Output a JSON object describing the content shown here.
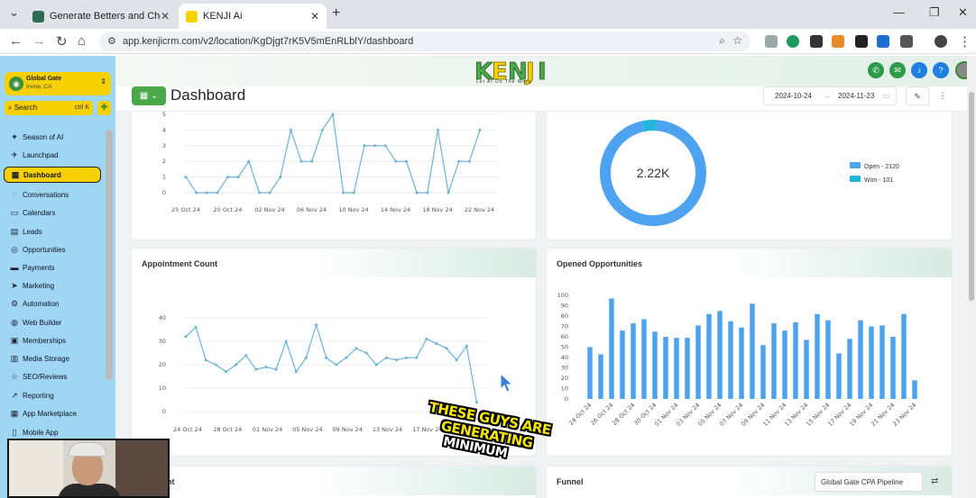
{
  "browser": {
    "tabs": [
      {
        "label": "Generate Betters and Cheaper L",
        "active": false
      },
      {
        "label": "KENJI Ai",
        "active": true
      }
    ],
    "url": "app.kenjicrm.com/v2/location/KgDjgt7rK5V5mEnRLblY/dashboard"
  },
  "brand": {
    "logo": "KENJI",
    "tagline": "Let AI Do The Work",
    "accent": "#f6d000",
    "green": "#4aa84a"
  },
  "sidebar": {
    "location_name": "Global Gate",
    "location_sub": "Irvine, CA",
    "search_label": "Search",
    "search_shortcut": "ctrl K",
    "items": [
      {
        "label": "Season of AI",
        "icon": "sparkle-icon"
      },
      {
        "label": "Launchpad",
        "icon": "rocket-icon"
      },
      {
        "label": "Dashboard",
        "icon": "grid-icon",
        "active": true
      },
      {
        "label": "Conversations",
        "icon": "chat-icon"
      },
      {
        "label": "Calendars",
        "icon": "calendar-icon"
      },
      {
        "label": "Leads",
        "icon": "contacts-icon"
      },
      {
        "label": "Opportunities",
        "icon": "target-icon"
      },
      {
        "label": "Payments",
        "icon": "card-icon"
      },
      {
        "label": "Marketing",
        "icon": "send-icon"
      },
      {
        "label": "Automation",
        "icon": "automation-icon"
      },
      {
        "label": "Web Builder",
        "icon": "globe-icon"
      },
      {
        "label": "Memberships",
        "icon": "membership-icon"
      },
      {
        "label": "Media Storage",
        "icon": "folder-icon"
      },
      {
        "label": "SEO/Reviews",
        "icon": "star-icon"
      },
      {
        "label": "Reporting",
        "icon": "trend-icon"
      },
      {
        "label": "App Marketplace",
        "icon": "apps-icon"
      },
      {
        "label": "Mobile App",
        "icon": "phone-icon"
      }
    ]
  },
  "header": {
    "title": "Dashboard",
    "date_from": "2024-10-24",
    "date_to": "2024-11-23"
  },
  "cards": {
    "top_left_chart": {
      "type": "line",
      "x_ticks": [
        "25 Oct 24",
        "20 Oct 24",
        "02 Nov 24",
        "06 Nov 24",
        "10 Nov 24",
        "14 Nov 24",
        "18 Nov 24",
        "22 Nov 24"
      ],
      "y_ticks": [
        "0",
        "1",
        "2",
        "3",
        "4",
        "5"
      ]
    },
    "donut": {
      "center_label": "2.22K",
      "legend": [
        {
          "label": "Open - 2120",
          "value": 2120,
          "color": "#4da3f0"
        },
        {
          "label": "Won - 101",
          "value": 101,
          "color": "#1fb6d9"
        }
      ]
    },
    "appointment": {
      "title": "Appointment Count"
    },
    "opened": {
      "title": "Opened Opportunities"
    },
    "bottom_left": {
      "title": "ts Count"
    },
    "funnel": {
      "title": "Funnel",
      "pipeline": "Global Gate CPA Pipeline"
    }
  },
  "chart_data": [
    {
      "type": "line",
      "title": "",
      "x": [
        "25 Oct 24",
        "26 Oct 24",
        "27 Oct 24",
        "28 Oct 24",
        "29 Oct 24",
        "30 Oct 24",
        "31 Oct 24",
        "01 Nov 24",
        "02 Nov 24",
        "03 Nov 24",
        "04 Nov 24",
        "05 Nov 24",
        "06 Nov 24",
        "07 Nov 24",
        "08 Nov 24",
        "09 Nov 24",
        "10 Nov 24",
        "11 Nov 24",
        "12 Nov 24",
        "13 Nov 24",
        "14 Nov 24",
        "15 Nov 24",
        "16 Nov 24",
        "17 Nov 24",
        "18 Nov 24",
        "19 Nov 24",
        "20 Nov 24",
        "21 Nov 24",
        "22 Nov 24"
      ],
      "values": [
        1,
        0,
        0,
        0,
        1,
        1,
        2,
        0,
        0,
        1,
        4,
        2,
        2,
        4,
        5,
        0,
        0,
        3,
        3,
        3,
        2,
        2,
        0,
        0,
        4,
        0,
        2,
        2,
        4
      ],
      "ylim": [
        0,
        5
      ],
      "color": "#6ab3d9"
    },
    {
      "type": "pie",
      "title": "",
      "categories": [
        "Open",
        "Won"
      ],
      "values": [
        2120,
        101
      ]
    },
    {
      "type": "line",
      "title": "Appointment Count",
      "x_ticks": [
        "24 Oct 24",
        "28 Oct 24",
        "01 Nov 24",
        "05 Nov 24",
        "09 Nov 24",
        "13 Nov 24",
        "17 Nov 24",
        "21 Nov 24"
      ],
      "values": [
        32,
        36,
        22,
        20,
        17,
        20,
        24,
        18,
        19,
        18,
        30,
        17,
        23,
        37,
        23,
        20,
        23,
        27,
        25,
        20,
        23,
        22,
        23,
        23,
        31,
        29,
        27,
        22,
        28,
        4
      ],
      "ylim": [
        0,
        40
      ],
      "color": "#6ab3d9"
    },
    {
      "type": "bar",
      "title": "Opened Opportunities",
      "x_ticks": [
        "24 Oct 24",
        "26 Oct 24",
        "28 Oct 24",
        "30 Oct 24",
        "01 Nov 24",
        "03 Nov 24",
        "05 Nov 24",
        "07 Nov 24",
        "09 Nov 24",
        "11 Nov 24",
        "13 Nov 24",
        "15 Nov 24",
        "17 Nov 24",
        "19 Nov 24",
        "21 Nov 24",
        "23 Nov 24"
      ],
      "values": [
        50,
        43,
        97,
        66,
        73,
        77,
        65,
        60,
        59,
        59,
        71,
        82,
        85,
        75,
        69,
        92,
        52,
        73,
        66,
        74,
        57,
        82,
        76,
        44,
        58,
        76,
        70,
        71,
        60,
        82,
        18
      ],
      "ylim": [
        0,
        100
      ],
      "color": "#4da3f0"
    }
  ],
  "overlay": {
    "caption_line1": "THESE GUYS ARE GENERATING",
    "caption_line2": "MINIMUM"
  }
}
